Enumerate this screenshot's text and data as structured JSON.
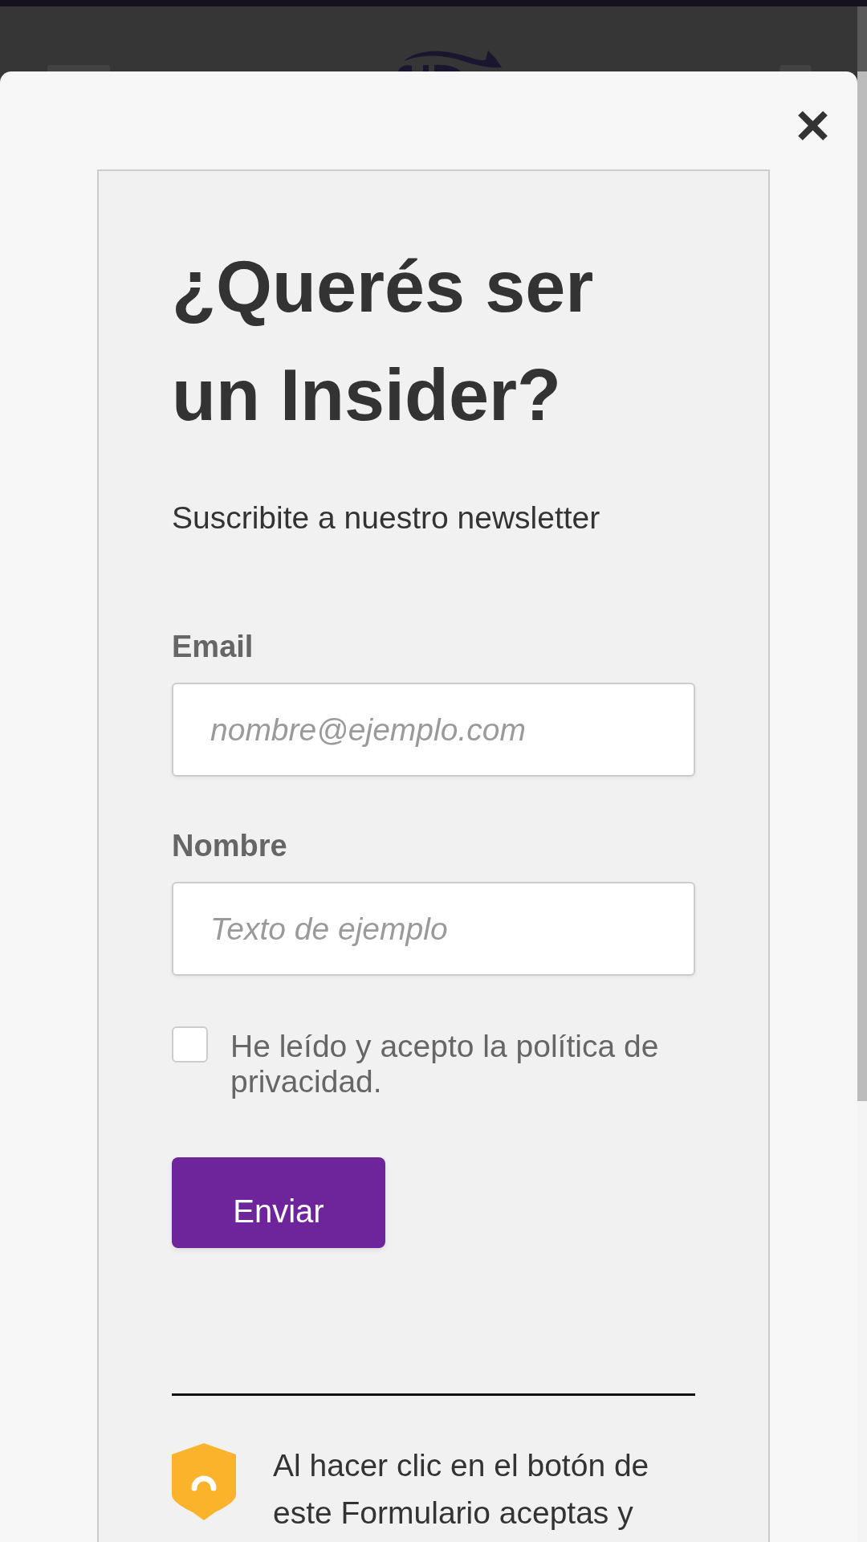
{
  "modal": {
    "title": "¿Querés ser un Insider?",
    "subtitle": "Suscribite a nuestro newsletter",
    "fields": [
      {
        "label": "Email",
        "placeholder": "nombre@ejemplo.com"
      },
      {
        "label": "Nombre",
        "placeholder": "Texto de ejemplo"
      }
    ],
    "consent": {
      "label": "He leído y acepto la política de privacidad.",
      "checked": false
    },
    "submit_button": "Enviar",
    "legal_notice": "Al hacer clic en el botón de este Formulario aceptas y"
  }
}
